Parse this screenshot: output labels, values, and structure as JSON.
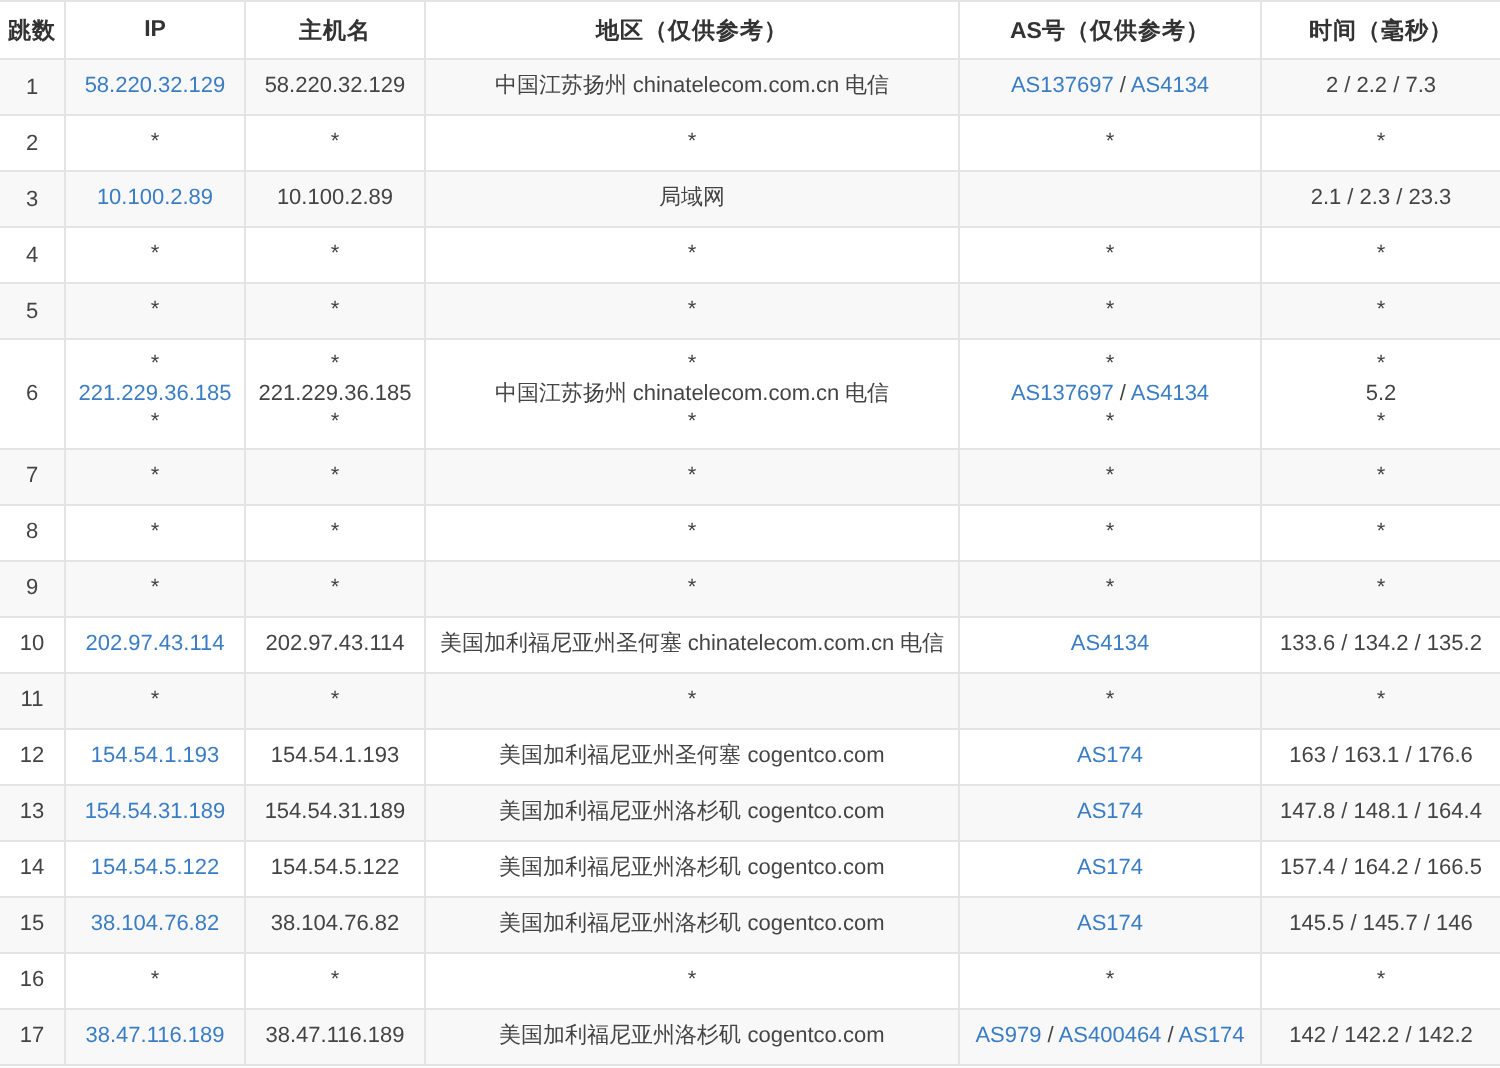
{
  "columns": [
    "跳数",
    "IP",
    "主机名",
    "地区（仅供参考）",
    "AS号（仅供参考）",
    "时间（毫秒）"
  ],
  "rows": [
    {
      "hop": "1",
      "ip": [
        {
          "text": "58.220.32.129",
          "link": true
        }
      ],
      "host": [
        "58.220.32.129"
      ],
      "region": [
        "中国江苏扬州 chinatelecom.com.cn 电信"
      ],
      "as": [
        [
          {
            "text": "AS137697",
            "link": true
          },
          {
            "text": "/",
            "link": false
          },
          {
            "text": "AS4134",
            "link": true
          }
        ]
      ],
      "time": [
        "2 / 2.2 / 7.3"
      ]
    },
    {
      "hop": "2",
      "ip": [
        {
          "text": "*",
          "link": false
        }
      ],
      "host": [
        "*"
      ],
      "region": [
        "*"
      ],
      "as": [
        [
          {
            "text": "*",
            "link": false
          }
        ]
      ],
      "time": [
        "*"
      ]
    },
    {
      "hop": "3",
      "ip": [
        {
          "text": "10.100.2.89",
          "link": true
        }
      ],
      "host": [
        "10.100.2.89"
      ],
      "region": [
        "局域网"
      ],
      "time": [
        "2.1 / 2.3 / 23.3"
      ]
    },
    {
      "hop": "4",
      "ip": [
        {
          "text": "*",
          "link": false
        }
      ],
      "host": [
        "*"
      ],
      "region": [
        "*"
      ],
      "as": [
        [
          {
            "text": "*",
            "link": false
          }
        ]
      ],
      "time": [
        "*"
      ]
    },
    {
      "hop": "5",
      "ip": [
        {
          "text": "*",
          "link": false
        }
      ],
      "host": [
        "*"
      ],
      "region": [
        "*"
      ],
      "as": [
        [
          {
            "text": "*",
            "link": false
          }
        ]
      ],
      "time": [
        "*"
      ]
    },
    {
      "hop": "6",
      "ip": [
        {
          "text": "*",
          "link": false
        },
        {
          "text": "221.229.36.185",
          "link": true
        },
        {
          "text": "*",
          "link": false
        }
      ],
      "host": [
        "*",
        "221.229.36.185",
        "*"
      ],
      "region": [
        "*",
        "中国江苏扬州 chinatelecom.com.cn 电信",
        "*"
      ],
      "as": [
        [
          {
            "text": "*",
            "link": false
          }
        ],
        [
          {
            "text": "AS137697",
            "link": true
          },
          {
            "text": "/",
            "link": false
          },
          {
            "text": "AS4134",
            "link": true
          }
        ],
        [
          {
            "text": "*",
            "link": false
          }
        ]
      ],
      "time": [
        "*",
        "5.2",
        "*"
      ]
    },
    {
      "hop": "7",
      "ip": [
        {
          "text": "*",
          "link": false
        }
      ],
      "host": [
        "*"
      ],
      "region": [
        "*"
      ],
      "as": [
        [
          {
            "text": "*",
            "link": false
          }
        ]
      ],
      "time": [
        "*"
      ]
    },
    {
      "hop": "8",
      "ip": [
        {
          "text": "*",
          "link": false
        }
      ],
      "host": [
        "*"
      ],
      "region": [
        "*"
      ],
      "as": [
        [
          {
            "text": "*",
            "link": false
          }
        ]
      ],
      "time": [
        "*"
      ]
    },
    {
      "hop": "9",
      "ip": [
        {
          "text": "*",
          "link": false
        }
      ],
      "host": [
        "*"
      ],
      "region": [
        "*"
      ],
      "as": [
        [
          {
            "text": "*",
            "link": false
          }
        ]
      ],
      "time": [
        "*"
      ]
    },
    {
      "hop": "10",
      "ip": [
        {
          "text": "202.97.43.114",
          "link": true
        }
      ],
      "host": [
        "202.97.43.114"
      ],
      "region": [
        "美国加利福尼亚州圣何塞 chinatelecom.com.cn 电信"
      ],
      "as": [
        [
          {
            "text": "AS4134",
            "link": true
          }
        ]
      ],
      "time": [
        "133.6 / 134.2 / 135.2"
      ]
    },
    {
      "hop": "11",
      "ip": [
        {
          "text": "*",
          "link": false
        }
      ],
      "host": [
        "*"
      ],
      "region": [
        "*"
      ],
      "as": [
        [
          {
            "text": "*",
            "link": false
          }
        ]
      ],
      "time": [
        "*"
      ]
    },
    {
      "hop": "12",
      "ip": [
        {
          "text": "154.54.1.193",
          "link": true
        }
      ],
      "host": [
        "154.54.1.193"
      ],
      "region": [
        "美国加利福尼亚州圣何塞 cogentco.com"
      ],
      "as": [
        [
          {
            "text": "AS174",
            "link": true
          }
        ]
      ],
      "time": [
        "163 / 163.1 / 176.6"
      ]
    },
    {
      "hop": "13",
      "ip": [
        {
          "text": "154.54.31.189",
          "link": true
        }
      ],
      "host": [
        "154.54.31.189"
      ],
      "region": [
        "美国加利福尼亚州洛杉矶 cogentco.com"
      ],
      "as": [
        [
          {
            "text": "AS174",
            "link": true
          }
        ]
      ],
      "time": [
        "147.8 / 148.1 / 164.4"
      ]
    },
    {
      "hop": "14",
      "ip": [
        {
          "text": "154.54.5.122",
          "link": true
        }
      ],
      "host": [
        "154.54.5.122"
      ],
      "region": [
        "美国加利福尼亚州洛杉矶 cogentco.com"
      ],
      "as": [
        [
          {
            "text": "AS174",
            "link": true
          }
        ]
      ],
      "time": [
        "157.4 / 164.2 / 166.5"
      ]
    },
    {
      "hop": "15",
      "ip": [
        {
          "text": "38.104.76.82",
          "link": true
        }
      ],
      "host": [
        "38.104.76.82"
      ],
      "region": [
        "美国加利福尼亚州洛杉矶 cogentco.com"
      ],
      "as": [
        [
          {
            "text": "AS174",
            "link": true
          }
        ]
      ],
      "time": [
        "145.5 / 145.7 / 146"
      ]
    },
    {
      "hop": "16",
      "ip": [
        {
          "text": "*",
          "link": false
        }
      ],
      "host": [
        "*"
      ],
      "region": [
        "*"
      ],
      "as": [
        [
          {
            "text": "*",
            "link": false
          }
        ]
      ],
      "time": [
        "*"
      ]
    },
    {
      "hop": "17",
      "ip": [
        {
          "text": "38.47.116.189",
          "link": true
        }
      ],
      "host": [
        "38.47.116.189"
      ],
      "region": [
        "美国加利福尼亚州洛杉矶 cogentco.com"
      ],
      "as": [
        [
          {
            "text": "AS979",
            "link": true
          },
          {
            "text": "/",
            "link": false
          },
          {
            "text": "AS400464",
            "link": true
          },
          {
            "text": "/",
            "link": false
          },
          {
            "text": "AS174",
            "link": true
          }
        ]
      ],
      "time": [
        "142 / 142.2 / 142.2"
      ]
    }
  ]
}
